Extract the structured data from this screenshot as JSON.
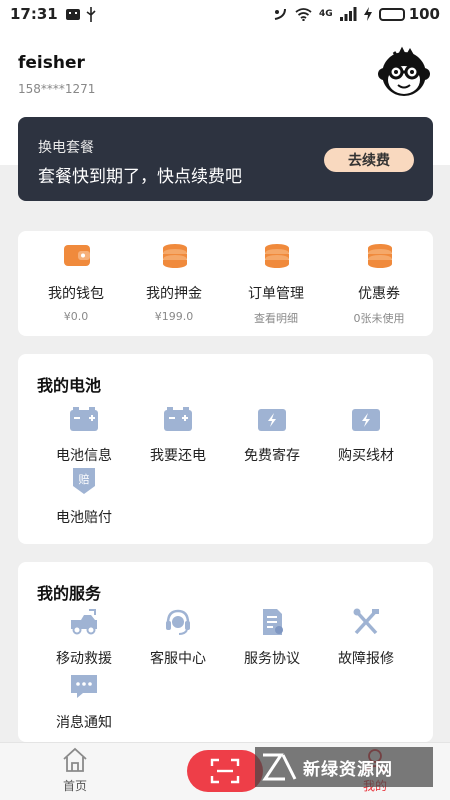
{
  "status_bar": {
    "time": "17:31",
    "network": "4G",
    "battery_level": 100,
    "battery_text": "100"
  },
  "user": {
    "name": "feisher",
    "phone": "158****1271"
  },
  "plan": {
    "title": "换电套餐",
    "message": "套餐快到期了，快点续费吧",
    "renew_label": "去续费"
  },
  "wallet_items": [
    {
      "label": "我的钱包",
      "value": "¥0.0",
      "icon": "wallet-icon"
    },
    {
      "label": "我的押金",
      "value": "¥199.0",
      "icon": "coins-icon"
    },
    {
      "label": "订单管理",
      "value": "查看明细",
      "icon": "coins-icon"
    },
    {
      "label": "优惠券",
      "value": "0张未使用",
      "icon": "coins-icon"
    }
  ],
  "battery_section": {
    "title": "我的电池",
    "items": [
      {
        "label": "电池信息",
        "icon": "battery-info-icon"
      },
      {
        "label": "我要还电",
        "icon": "battery-return-icon"
      },
      {
        "label": "免费寄存",
        "icon": "battery-charge-icon"
      },
      {
        "label": "购买线材",
        "icon": "battery-charge-icon"
      },
      {
        "label": "电池赔付",
        "icon": "compensation-icon",
        "badge": "赔"
      }
    ]
  },
  "service_section": {
    "title": "我的服务",
    "items": [
      {
        "label": "移动救援",
        "icon": "tow-truck-icon"
      },
      {
        "label": "客服中心",
        "icon": "headset-icon"
      },
      {
        "label": "服务协议",
        "icon": "document-icon"
      },
      {
        "label": "故障报修",
        "icon": "tools-icon"
      },
      {
        "label": "消息通知",
        "icon": "message-icon"
      }
    ]
  },
  "tab_bar": {
    "home_label": "首页",
    "mine_label": "我的",
    "scan_icon": "scan-icon"
  },
  "watermark": {
    "text": "新绿资源网"
  },
  "colors": {
    "accent": "#ee3e48",
    "plan_bg": "#2d3340",
    "renew_bg": "#f9d9bf",
    "orange": "#f08a3c",
    "icon_blue": "#9fb3d3"
  }
}
